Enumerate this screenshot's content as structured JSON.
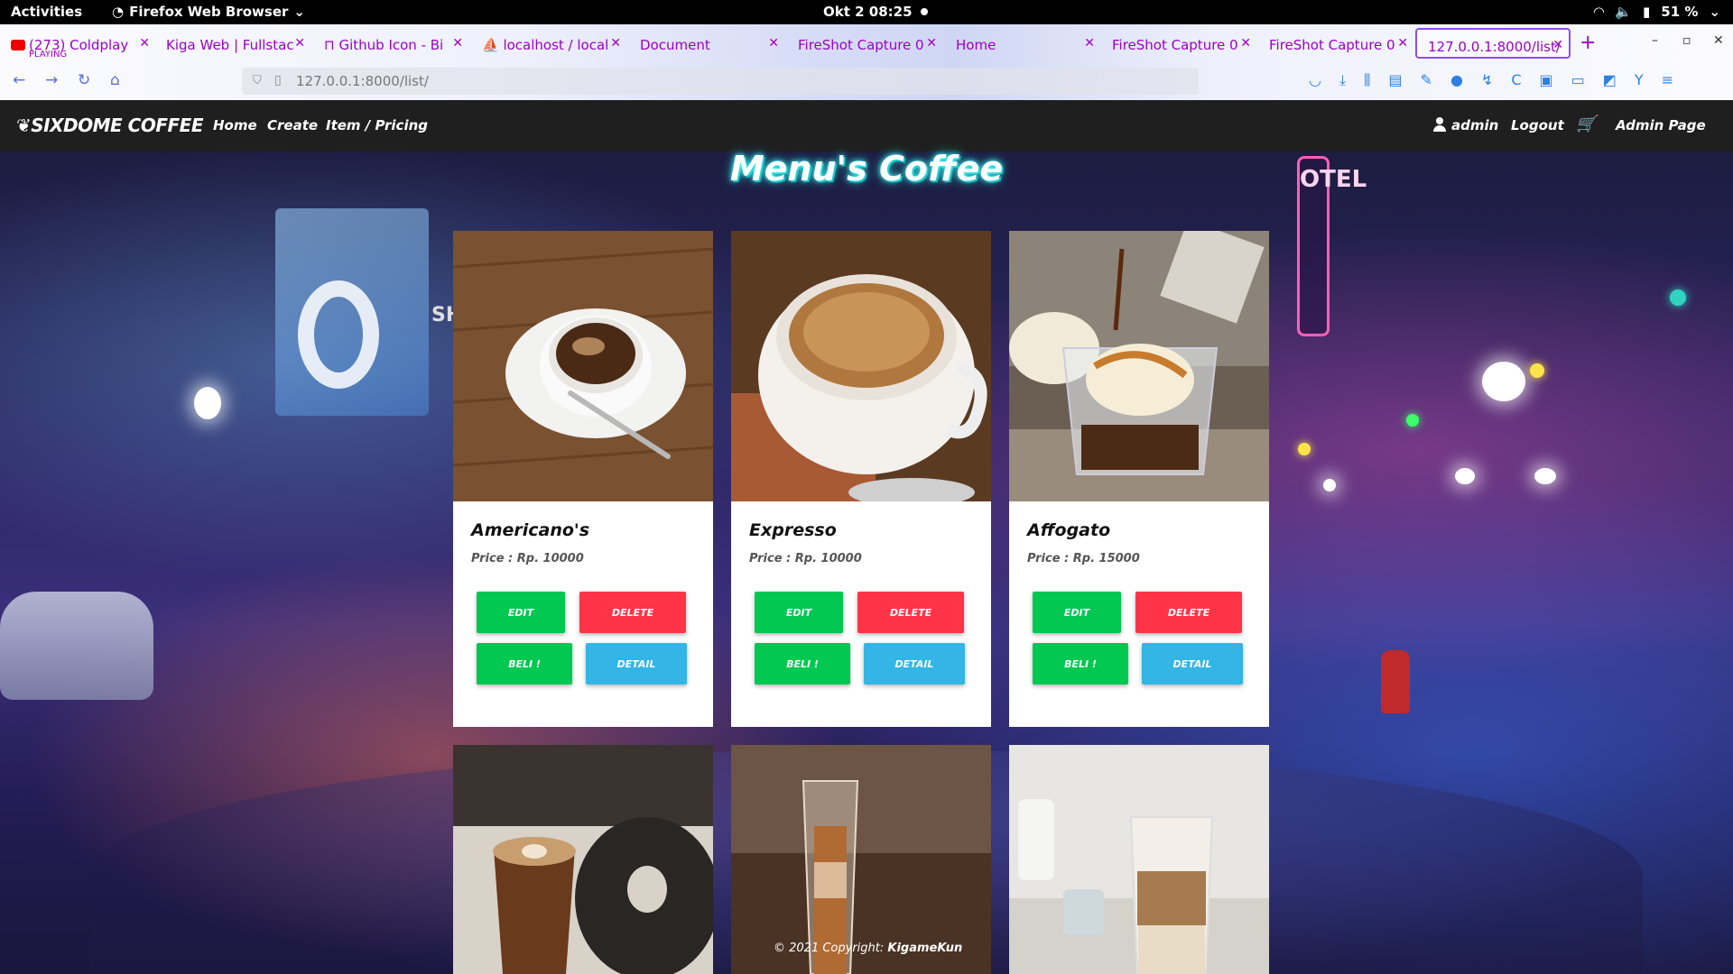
{
  "system": {
    "activities": "Activities",
    "app_name": "Firefox Web Browser",
    "clock": "Okt 2  08:25",
    "battery": "51 %"
  },
  "browser": {
    "tabs": [
      {
        "label": "(273) Coldplay",
        "sub": "PLAYING"
      },
      {
        "label": "Kiga Web | Fullstac"
      },
      {
        "label": "Github Icon - Bi"
      },
      {
        "label": "localhost / local"
      },
      {
        "label": "Document"
      },
      {
        "label": "FireShot Capture 0"
      },
      {
        "label": "Home"
      },
      {
        "label": "FireShot Capture 0"
      },
      {
        "label": "FireShot Capture 0"
      },
      {
        "label": "127.0.0.1:8000/list/"
      }
    ],
    "url": "127.0.0.1:8000/list/"
  },
  "site": {
    "brand": "SIXDOME COFFEE",
    "nav": {
      "home": "Home",
      "create": "Create",
      "item_pricing": "Item / Pricing",
      "user": "admin",
      "logout": "Logout",
      "admin_page": "Admin Page"
    },
    "title": "Menu's Coffee",
    "scene": {
      "shop_sign": "SHOP",
      "hotel_sign": "OTEL"
    },
    "buttons": {
      "edit": "EDIT",
      "delete": "DELETE",
      "buy": "BELI !",
      "detail": "DETAIL"
    },
    "items": [
      {
        "name": "Americano's",
        "price": "Price : Rp. 10000"
      },
      {
        "name": "Expresso",
        "price": "Price : Rp. 10000"
      },
      {
        "name": "Affogato",
        "price": "Price : Rp. 15000"
      }
    ],
    "footer": {
      "text": "© 2021 Copyright:",
      "author": "KigameKun"
    }
  }
}
